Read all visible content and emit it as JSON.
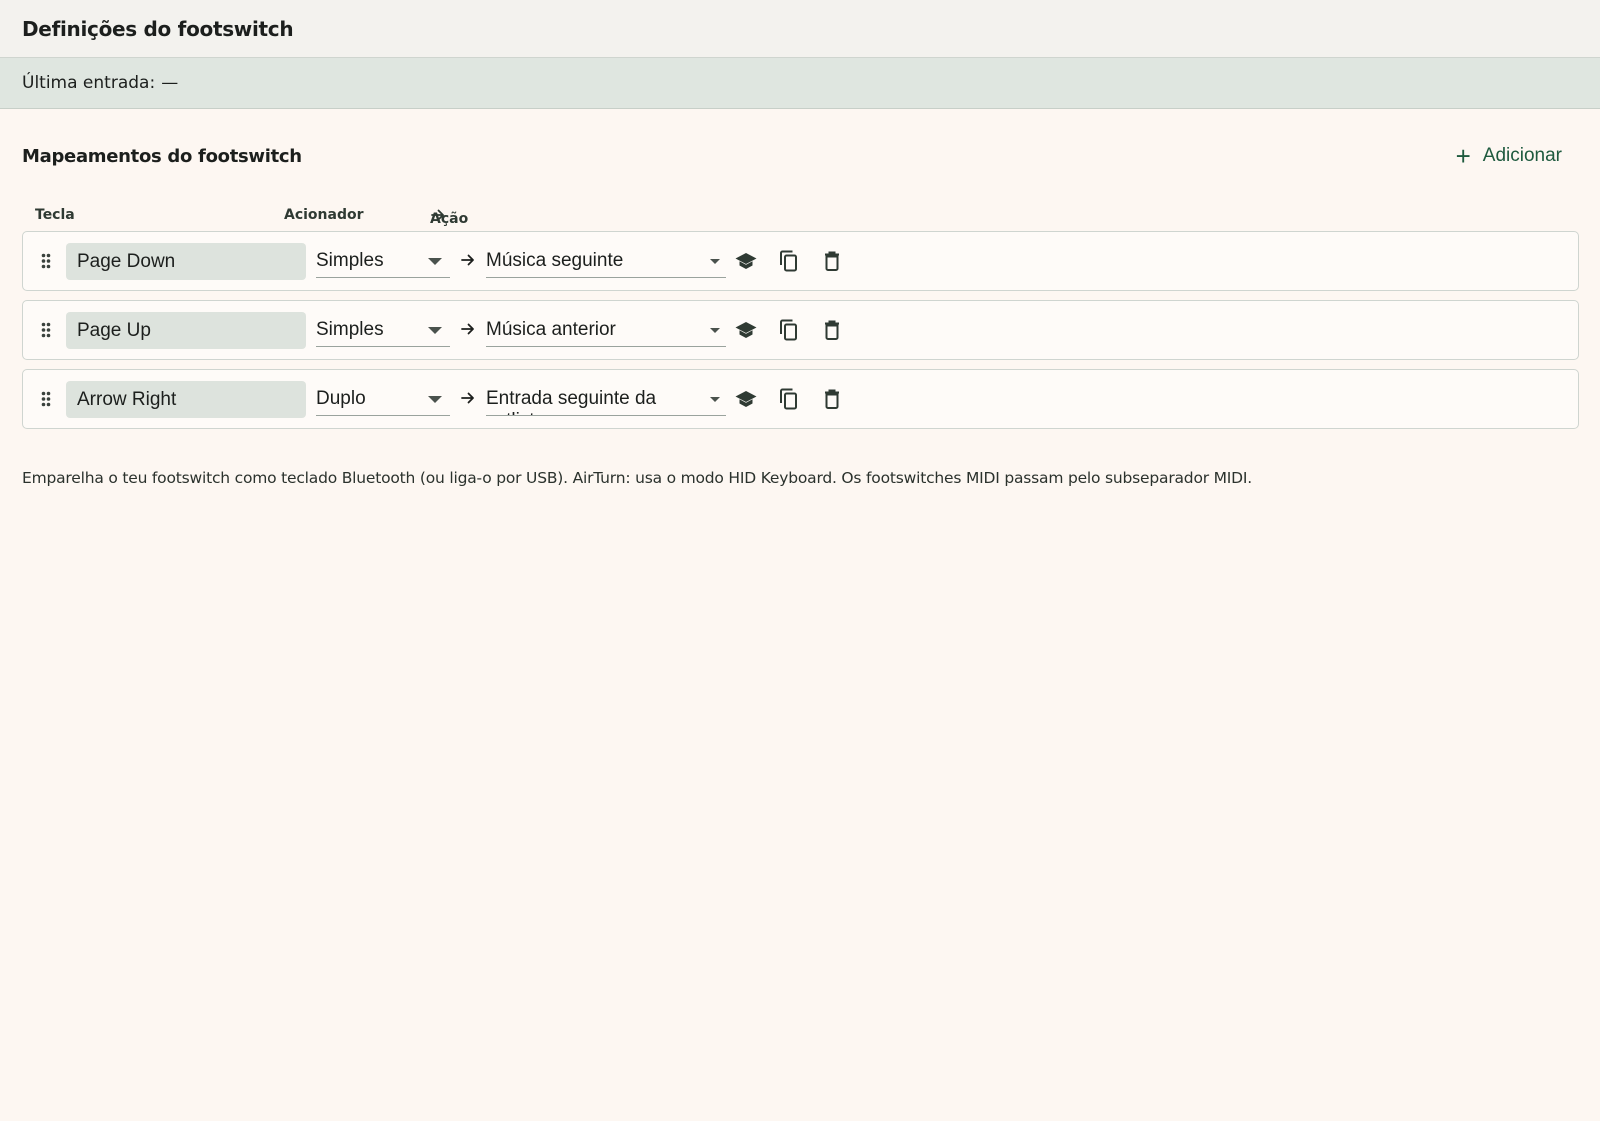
{
  "header": {
    "title": "Definições do footswitch"
  },
  "status": {
    "label": "Última entrada:",
    "value": "—"
  },
  "section": {
    "title": "Mapeamentos do footswitch",
    "add_label": "Adicionar"
  },
  "columns": {
    "key": "Tecla",
    "trigger": "Acionador",
    "action": "Ação"
  },
  "mappings": [
    {
      "key": "Page Down",
      "trigger": "Simples",
      "action": "Música seguinte"
    },
    {
      "key": "Page Up",
      "trigger": "Simples",
      "action": "Música anterior"
    },
    {
      "key": "Arrow Right",
      "trigger": "Duplo",
      "action": "Entrada seguinte da setlist"
    }
  ],
  "help_text": "Emparelha o teu footswitch como teclado Bluetooth (ou liga-o por USB). AirTurn: usa o modo HID Keyboard. Os footswitches MIDI passam pelo subseparador MIDI.",
  "icons": {
    "drag": "drag-handle-icon",
    "arrow": "arrow-right-icon",
    "learn": "graduation-cap-icon",
    "copy": "copy-icon",
    "delete": "trash-icon",
    "add": "plus-icon"
  },
  "colors": {
    "accent": "#1e5a3e",
    "background": "#fdf7f2",
    "status_bar": "#dfe6e0",
    "key_field": "#dde3dd"
  }
}
